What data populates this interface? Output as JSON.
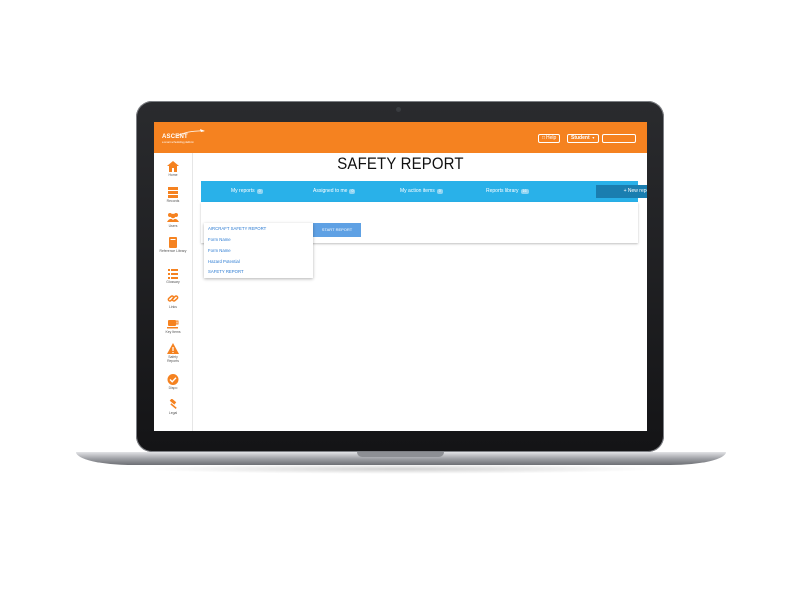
{
  "app": {
    "logo_text": "ASCENT",
    "logo_tagline": "a smart scheduling platform"
  },
  "header": {
    "help_label": "Help",
    "user_label": "Student",
    "search_value": ""
  },
  "sidebar": {
    "items": [
      {
        "label": "Home",
        "icon": "home-icon"
      },
      {
        "label": "Records",
        "icon": "records-icon"
      },
      {
        "label": "Users",
        "icon": "users-icon"
      },
      {
        "label": "Reference Library",
        "icon": "book-icon"
      },
      {
        "label": "Glossary",
        "icon": "list-icon"
      },
      {
        "label": "Links",
        "icon": "link-icon"
      },
      {
        "label": "Key Items",
        "icon": "coffee-icon"
      },
      {
        "label": "Safety Reports",
        "icon": "warning-icon"
      },
      {
        "label": "Dispo",
        "icon": "check-circle-icon"
      },
      {
        "label": "Legal",
        "icon": "gavel-icon"
      }
    ]
  },
  "page": {
    "title": "SAFETY REPORT"
  },
  "tabs": [
    {
      "label": "My reports",
      "count": "0"
    },
    {
      "label": "Assigned to me",
      "count": "0"
    },
    {
      "label": "My action items",
      "count": "0"
    },
    {
      "label": "Reports library",
      "count": "16"
    }
  ],
  "new_report_label": "+ New report",
  "start_report_label": "START REPORT",
  "dropdown": {
    "options": [
      "AIRCRAFT SAFETY REPORT",
      "Form Name",
      "Form Name",
      "Hazard Potential",
      "SAFETY REPORT"
    ]
  },
  "colors": {
    "brand_orange": "#f58220",
    "tab_blue": "#29b1e9",
    "new_report_blue": "#1a7eb0",
    "start_button_blue": "#5fa1e4",
    "link_blue": "#2a7ad2"
  }
}
